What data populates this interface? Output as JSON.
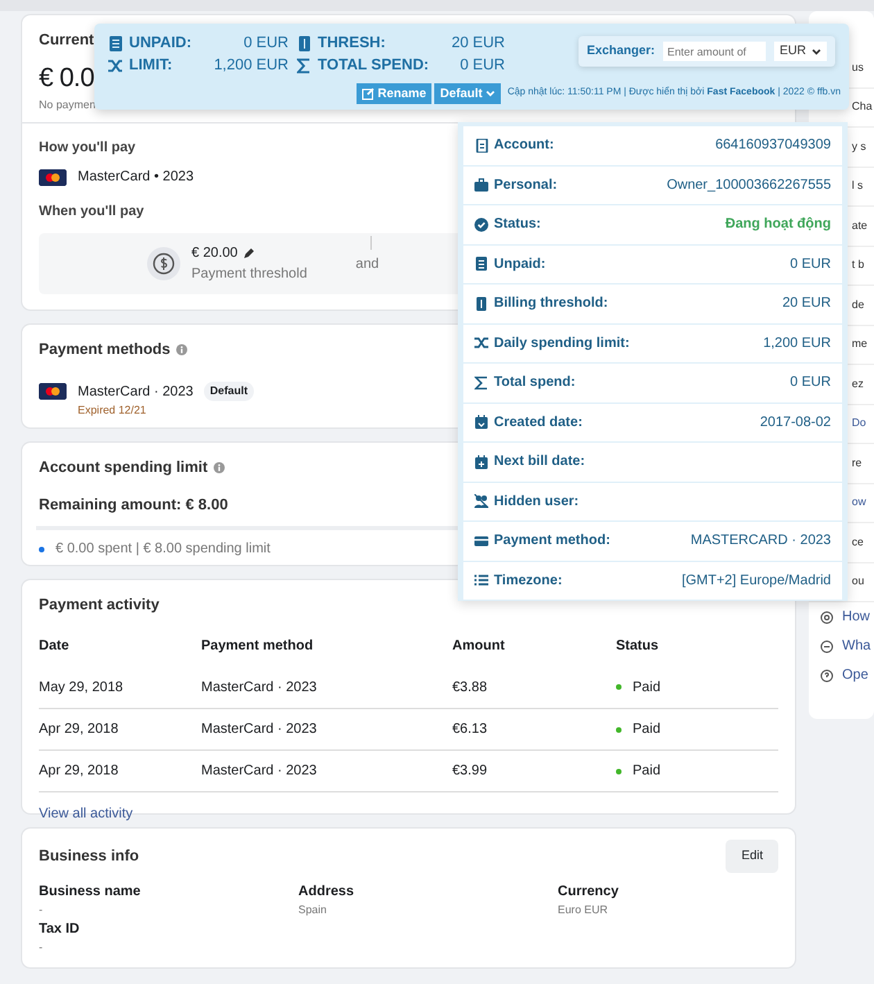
{
  "header_card": {
    "title": "Current",
    "amount": "€ 0.0",
    "note": "No paymen"
  },
  "how_you_pay": {
    "label": "How you'll pay",
    "card": "MasterCard • 2023",
    "when_label": "When you'll pay",
    "threshold_amount": "€ 20.00",
    "threshold_label": "Payment threshold",
    "joiner": "and"
  },
  "payment_methods": {
    "title": "Payment methods",
    "card": "MasterCard · 2023",
    "badge": "Default",
    "expiry": "Expired 12/21"
  },
  "spending_limit": {
    "title": "Account spending limit",
    "remaining": "Remaining amount: € 8.00",
    "detail": "€ 0.00 spent | € 8.00 spending limit"
  },
  "payment_activity": {
    "title": "Payment activity",
    "columns": [
      "Date",
      "Payment method",
      "Amount",
      "Status"
    ],
    "rows": [
      {
        "date": "May 29, 2018",
        "method": "MasterCard · 2023",
        "amount": "€3.88",
        "status": "Paid"
      },
      {
        "date": "Apr 29, 2018",
        "method": "MasterCard · 2023",
        "amount": "€6.13",
        "status": "Paid"
      },
      {
        "date": "Apr 29, 2018",
        "method": "MasterCard · 2023",
        "amount": "€3.99",
        "status": "Paid"
      }
    ],
    "link": "View all activity"
  },
  "business_info": {
    "title": "Business info",
    "edit_button": "Edit",
    "fields": [
      {
        "label": "Business name",
        "value": "-"
      },
      {
        "label": "Address",
        "value": "Spain"
      },
      {
        "label": "Currency",
        "value": "Euro EUR"
      },
      {
        "label": "Tax ID",
        "value": "-"
      }
    ]
  },
  "sidebar": {
    "fragments": [
      "us",
      "Cha",
      "y s",
      "l s",
      "ate",
      "t b",
      "de",
      "me",
      "ez",
      "Do",
      "re",
      "ow",
      "ce",
      "ou"
    ],
    "links": [
      "How",
      "Wha",
      "Ope"
    ]
  },
  "extension_bar": {
    "stats": [
      {
        "label": "UNPAID:",
        "value": "0 EUR"
      },
      {
        "label": "THRESH:",
        "value": "20 EUR"
      },
      {
        "label": "LIMIT:",
        "value": "1,200 EUR"
      },
      {
        "label": "TOTAL SPEND:",
        "value": "0 EUR"
      }
    ],
    "exchanger_label": "Exchanger:",
    "exchanger_placeholder": "Enter amount of",
    "currency": "EUR",
    "rename_button": "Rename",
    "profile_select": "Default",
    "footer": "Cập nhật lúc: 11:50:11 PM | Được hiển thị bởi **Fast Facebook** | 2022 © ffb.vn"
  },
  "account_panel": {
    "rows": [
      {
        "label": "Account:",
        "value": "664160937049309"
      },
      {
        "label": "Personal:",
        "value": "Owner_100003662267555"
      },
      {
        "label": "Status:",
        "value": "Đang hoạt động",
        "kind": "status"
      },
      {
        "label": "Unpaid:",
        "value": "0 EUR"
      },
      {
        "label": "Billing threshold:",
        "value": "20 EUR"
      },
      {
        "label": "Daily spending limit:",
        "value": "1,200 EUR"
      },
      {
        "label": "Total spend:",
        "value": "0 EUR"
      },
      {
        "label": "Created date:",
        "value": "2017-08-02"
      },
      {
        "label": "Next bill date:"
      },
      {
        "label": "Hidden user:"
      },
      {
        "label": "Payment method:",
        "value": "MASTERCARD · 2023"
      },
      {
        "label": "Timezone:",
        "value": "[GMT+2] Europe/Madrid"
      }
    ]
  }
}
